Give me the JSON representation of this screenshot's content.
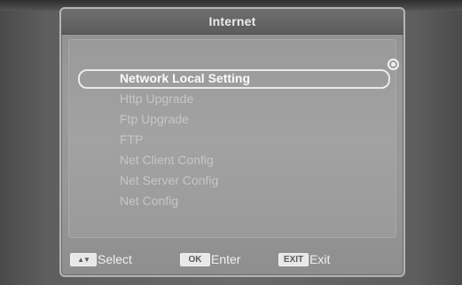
{
  "window": {
    "title": "Internet"
  },
  "menu": {
    "items": [
      {
        "label": "Network Local Setting",
        "selected": true
      },
      {
        "label": "Http Upgrade",
        "selected": false
      },
      {
        "label": "Ftp Upgrade",
        "selected": false
      },
      {
        "label": "FTP",
        "selected": false
      },
      {
        "label": "Net Client Config",
        "selected": false
      },
      {
        "label": "Net Server Config",
        "selected": false
      },
      {
        "label": "Net Config",
        "selected": false
      }
    ]
  },
  "footer": {
    "select": {
      "key": "▲▼",
      "label": "Select"
    },
    "enter": {
      "key": "OK",
      "label": "Enter"
    },
    "exit": {
      "key": "EXIT",
      "label": "Exit"
    }
  },
  "icons": {
    "selection_indicator": "radio-selected-icon"
  }
}
